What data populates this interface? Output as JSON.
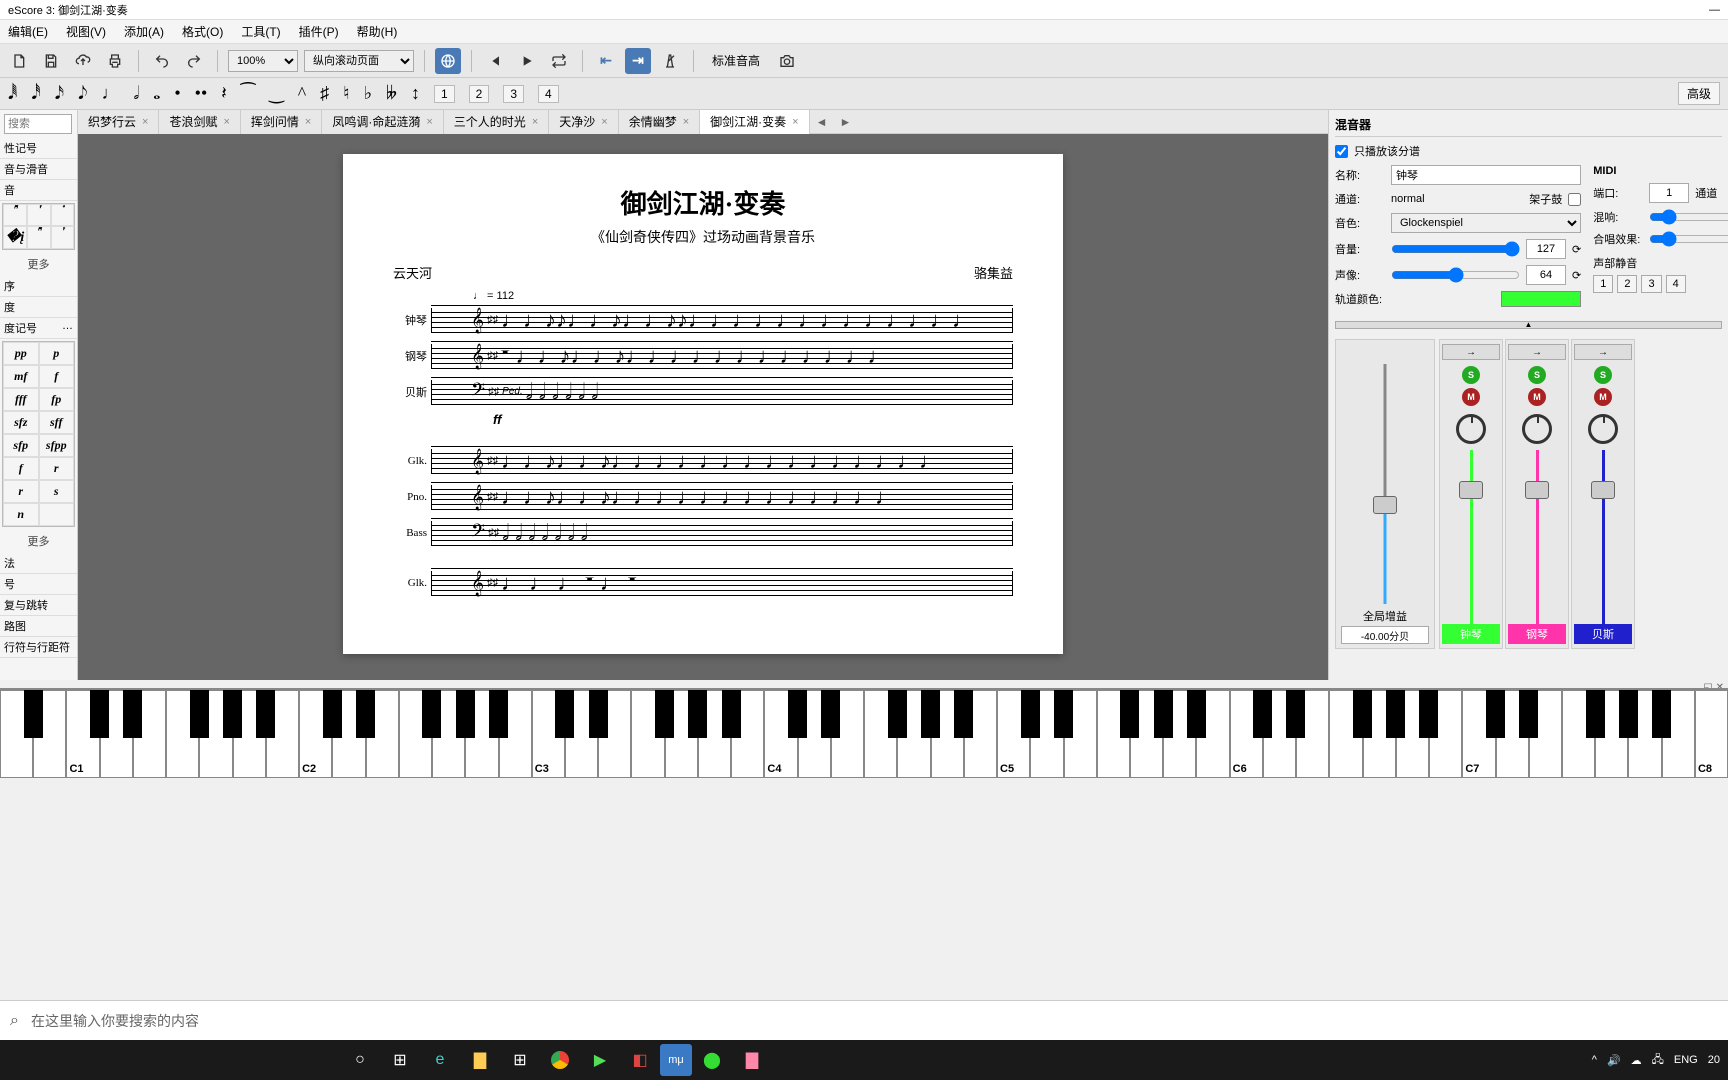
{
  "window": {
    "title": "eScore 3: 御剑江湖·变奏",
    "minimize": "—"
  },
  "menu": [
    "编辑(E)",
    "视图(V)",
    "添加(A)",
    "格式(O)",
    "工具(T)",
    "插件(P)",
    "帮助(H)"
  ],
  "toolbar": {
    "zoom": "100%",
    "layout": "纵向滚动页面",
    "pitch_label": "标准音高",
    "advanced": "高级"
  },
  "note_numbers": [
    "1",
    "2",
    "3",
    "4"
  ],
  "left": {
    "search_placeholder": "搜索",
    "sections": [
      "性记号",
      "音与滑音",
      "音"
    ],
    "more": "更多",
    "sections2": [
      "序",
      "度",
      "度记号"
    ],
    "dynamics": [
      [
        "pp",
        "p"
      ],
      [
        "mf",
        "f"
      ],
      [
        "fff",
        "fp"
      ],
      [
        "sfz",
        "sff"
      ],
      [
        "sfp",
        "sfpp"
      ],
      [
        "f",
        "r"
      ],
      [
        "r",
        "s"
      ],
      [
        "n",
        ""
      ]
    ],
    "sections3": [
      "法",
      "号",
      "复与跳转",
      "路图",
      "行符与行距符"
    ]
  },
  "tabs": [
    {
      "label": "织梦行云"
    },
    {
      "label": "苍浪剑赋"
    },
    {
      "label": "挥剑问情"
    },
    {
      "label": "凤鸣调·命起涟漪"
    },
    {
      "label": "三个人的时光"
    },
    {
      "label": "天净沙"
    },
    {
      "label": "余情幽梦"
    },
    {
      "label": "御剑江湖·变奏",
      "active": true
    }
  ],
  "score": {
    "title": "御剑江湖·变奏",
    "subtitle": "《仙剑奇侠传四》过场动画背景音乐",
    "left_credit": "云天河",
    "right_credit": "骆集益",
    "tempo": "♩ = 112",
    "staves1": [
      "钟琴",
      "钢琴",
      "贝斯"
    ],
    "staves2": [
      "Glk.",
      "Pno.",
      "Bass"
    ],
    "staves3": [
      "Glk."
    ],
    "ped": "Ped.",
    "ff": "ff"
  },
  "mixer": {
    "title": "混音器",
    "only_play": "只播放该分谱",
    "name_label": "名称:",
    "name_value": "钟琴",
    "midi_label": "MIDI",
    "channel_label": "通道:",
    "channel_value": "normal",
    "drum_label": "架子鼓",
    "port_label": "端口:",
    "port_value": "1",
    "channel2_label": "通道",
    "sound_label": "音色:",
    "sound_value": "Glockenspiel",
    "reverb_label": "混响:",
    "chorus_label": "合唱效果:",
    "volume_label": "音量:",
    "volume_value": "127",
    "pan_label": "声像:",
    "pan_value": "64",
    "color_label": "轨道颜色:",
    "mute_label": "声部静音",
    "mute_buttons": [
      "1",
      "2",
      "3",
      "4"
    ],
    "global_gain": "全局增益",
    "gain_value": "-40.00分贝",
    "tracks": [
      {
        "name": "钟琴",
        "color": "#33ff33"
      },
      {
        "name": "钢琴",
        "color": "#ff33aa"
      },
      {
        "name": "贝斯",
        "color": "#2020cc"
      }
    ]
  },
  "piano": {
    "octaves": [
      "C1",
      "C2",
      "C3",
      "C4",
      "C5",
      "C6",
      "C7",
      "C8"
    ]
  },
  "taskbar": {
    "search_placeholder": "在这里输入你要搜索的内容",
    "lang": "ENG",
    "time": "20"
  }
}
